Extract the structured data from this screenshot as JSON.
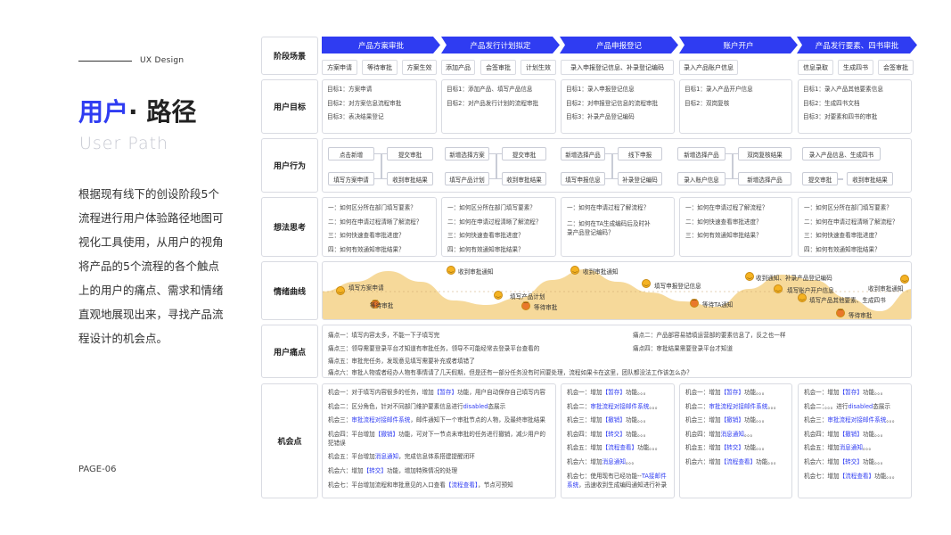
{
  "header": {
    "ux_label": "UX Design",
    "title_blue": "用户",
    "title_rest": "· 路径",
    "subtitle": "User  Path",
    "description": "根据现有线下的创设阶段5个流程进行用户体验路径地图可视化工具使用，从用户的视角将产品的5个流程的各个触点上的用户的痛点、需求和情绪直观地展现出来，寻找产品流程设计的机会点。",
    "page": "PAGE-06"
  },
  "rows": {
    "stage": "阶段场景",
    "goal": "用户目标",
    "action": "用户行为",
    "think": "想法思考",
    "emotion": "情绪曲线",
    "pain": "用户痛点",
    "opp": "机会点"
  },
  "stages": [
    "产品方案审批",
    "产品发行计划拟定",
    "产品申报登记",
    "账户开户",
    "产品发行要素、四书审批"
  ],
  "tags": [
    "方案申请",
    "等待审批",
    "方案生效",
    "添加产品",
    "会签审批",
    "计划生效",
    "录入申报登记信息、补录登记编码",
    "录入产品账户信息",
    "信息录取",
    "生成四书",
    "会签审批"
  ],
  "goals": [
    [
      "目标1：方案申请",
      "目标2：对方案信息流程审批",
      "目标3：表决结果登记"
    ],
    [
      "目标1：添加产品、填写产品信息",
      "目标2：对产品发行计划的流程审批"
    ],
    [
      "目标1：录入申报登记信息",
      "目标2：对申报登记信息的流程审批",
      "目标3：补录产品登记编码"
    ],
    [
      "目标1：录入产品开户信息",
      "目标2：双岗复核"
    ],
    [
      "目标1：录入产品其他要素信息",
      "目标2：生成四书文档",
      "目标3：对要素和四书的审批"
    ]
  ],
  "actions": {
    "s1": [
      "点击新增",
      "填写方案申请",
      "提交审批",
      "收到审批结果"
    ],
    "s2": [
      "新增选择方案",
      "填写产品计划",
      "提交审批",
      "收到审批结果"
    ],
    "s3": [
      "新增选择产品",
      "填写申报信息",
      "线下申报",
      "补录登记编码"
    ],
    "s4": [
      "新增选择产品",
      "录入账户信息",
      "双岗复核结果",
      "新增选择产品"
    ],
    "s5": [
      "录入产品信息、生成四书",
      "提交审批",
      "收到审批结果"
    ]
  },
  "thinks": [
    [
      "一：如何区分所在部门填写要素？",
      "二：如何在申请过程清晰了解流程？",
      "三：如何快速查看审批进度？",
      "四：如何有效通知审批结果？"
    ],
    [
      "一：如何区分所在部门填写要素？",
      "二：如何在申请过程清晰了解流程？",
      "三：如何快速查看审批进度？",
      "四：如何有效通知审批结果？"
    ],
    [
      "一：如何在申请过程了解流程？",
      "二：如何在TA生成编码后及时补录产品登记编码？"
    ],
    [
      "一：如何在申请过程了解流程？",
      "二：如何快速查看审批进度？",
      "三：如何有效通知审批结果？"
    ],
    [
      "一：如何区分所在部门填写要素？",
      "二：如何在申请过程清晰了解流程？",
      "三：如何快速查看审批进度？",
      "四：如何有效通知审批结果？"
    ]
  ],
  "emotions": [
    "填写方案申请",
    "等待审批",
    "收到审批通知",
    "填写产品计划",
    "等待审批",
    "收到审批通知",
    "填写申报登记信息",
    "等待TA通知",
    "收到通知、补录产品登记编码",
    "填写账户开户信息",
    "填写产品其他要素、生成四书",
    "等待审批",
    "收到审批通知"
  ],
  "pains": {
    "p1": "痛点一：填写内容太多，不能一下子填写完",
    "p2": "痛点二：产品部容易错填运营部的要素信息了，反之也一样",
    "p3": "痛点三：领导需要登录平台才知道有审批任务，领导不可能经常去登录平台查看的",
    "p4": "痛点四：审批结果需要登录平台才知道",
    "p5": "痛点五：审批完任务，发现意见填写需要补充或者填错了",
    "p6": "痛点六：审批人物或者经办人物有事情请了几天假期，但是还有一部分任务没有时间要处理，流程如果卡在这里，团队都没法工作该怎么办？"
  },
  "opps": {
    "c1": [
      [
        "机会一：对于填写内容很多的任务，增加",
        "【暂存】",
        "功能，用户自动保存自己填写内容"
      ],
      [
        "机会二：区分角色，针对不同部门维护要素信息进行",
        "disabled",
        "态展示"
      ],
      [
        "机会三：",
        "审批流程对接邮件系统",
        "，邮件通知下一个审批节点的人物，及最终审批结果"
      ],
      [
        "机会四：平台增加",
        "【撤销】",
        "功能，可对下一节点未审批的任务进行撤销，减少用户的犯错误"
      ],
      [
        "机会五：平台增加",
        "消息通知",
        "，完成信息体系搭建提醒闭环"
      ],
      [
        "机会六：增加",
        "【转交】",
        "功能，增加特殊情况的处理"
      ],
      [
        "机会七：平台增加流程和审批意见的入口查看",
        "【流程查看】",
        "，节点可预知"
      ]
    ],
    "c2": [
      [
        "机会一：增加",
        "【暂存】",
        "功能。。。"
      ],
      [
        "机会二：",
        "审批流程对接邮件系统",
        "。。。"
      ],
      [
        "机会三：增加",
        "【撤销】",
        "功能。。。"
      ],
      [
        "机会四：增加",
        "【转交】",
        "功能。。。"
      ],
      [
        "机会五：增加",
        "【流程查看】",
        "功能。。。"
      ],
      [
        "机会六：增加",
        "消息通知",
        "。。。"
      ],
      [
        "机会七：使用现有已经功能--",
        "TA接邮件系统",
        "，迅速收到生成编码通知进行补录"
      ]
    ],
    "c3": [
      [
        "机会一：增加",
        "【暂存】",
        "功能。。。"
      ],
      [
        "机会二：",
        "审批流程对接邮件系统",
        "。。。"
      ],
      [
        "机会三：增加",
        "【撤销】",
        "功能。。。"
      ],
      [
        "机会四：增加",
        "消息通知",
        "。。。"
      ],
      [
        "机会五：增加",
        "【转交】",
        "功能。。。"
      ],
      [
        "机会六：增加",
        "【流程查看】",
        "功能。。。"
      ]
    ],
    "c4": [
      [
        "机会一：增加",
        "【暂存】",
        "功能。。。"
      ],
      [
        "机会二：。。。进行",
        "disabled",
        "态展示"
      ],
      [
        "机会三：",
        "审批流程对接邮件系统",
        "。。。"
      ],
      [
        "机会四：增加",
        "【撤销】",
        "功能。。。"
      ],
      [
        "机会五：增加",
        "消息通知",
        "。。。"
      ],
      [
        "机会六：增加",
        "【转交】",
        "功能。。。"
      ],
      [
        "机会七：增加",
        "【流程查看】",
        "功能。。。"
      ]
    ]
  },
  "colors": {
    "accent": "#2f3cf2",
    "wave": "#f6d99a",
    "emoji": "#f5b323",
    "border": "#d9dbe2"
  }
}
